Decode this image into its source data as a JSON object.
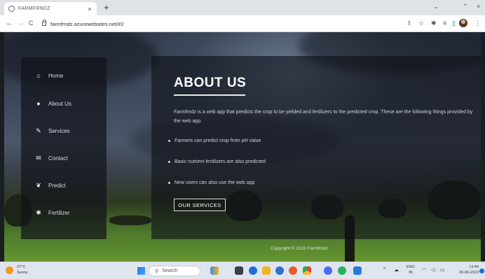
{
  "browser": {
    "tab_title": "FARMFRNDZ",
    "tab_close": "×",
    "new_tab": "+",
    "url": "farmfrndz.azurewebsites.net/#2",
    "back": "←",
    "forward": "→",
    "reload": "C",
    "min": "⌄",
    "restore": "⌃",
    "close": "×"
  },
  "sidebar": {
    "items": [
      {
        "label": "Home",
        "icon": "home-icon",
        "glyph": "⌂"
      },
      {
        "label": "About Us",
        "icon": "user-icon",
        "glyph": "●"
      },
      {
        "label": "Services",
        "icon": "pencil-icon",
        "glyph": "✎"
      },
      {
        "label": "Contact",
        "icon": "mail-icon",
        "glyph": "✉"
      },
      {
        "label": "Predict",
        "icon": "leaf-icon",
        "glyph": "❦"
      },
      {
        "label": "Fertilizer",
        "icon": "sparkle-icon",
        "glyph": "✱"
      }
    ]
  },
  "content": {
    "heading": "ABOUT US",
    "intro": "Farmfrndz is a web app that predicts the crop to be yielded and fertilizers to the predicted crop. These are the following things provided by the web app.",
    "bullets": [
      "Farmers can predict crop from pH value",
      "Basic nutrient fertilizers are also predicted",
      "New users can also use the web app"
    ],
    "button": "OUR SERVICES"
  },
  "footer": {
    "copyright": "Copyright © 2023 Farmfrndz"
  },
  "taskbar": {
    "weather_temp": "27°C",
    "weather_desc": "Sunny",
    "search_placeholder": "Search",
    "lang_top": "ENG",
    "lang_bottom": "IN",
    "time": "13:40",
    "date": "26-06-2023"
  },
  "colors": {
    "accent": "#ffffff",
    "panel": "#0e1016",
    "field": "#5c8a33"
  }
}
